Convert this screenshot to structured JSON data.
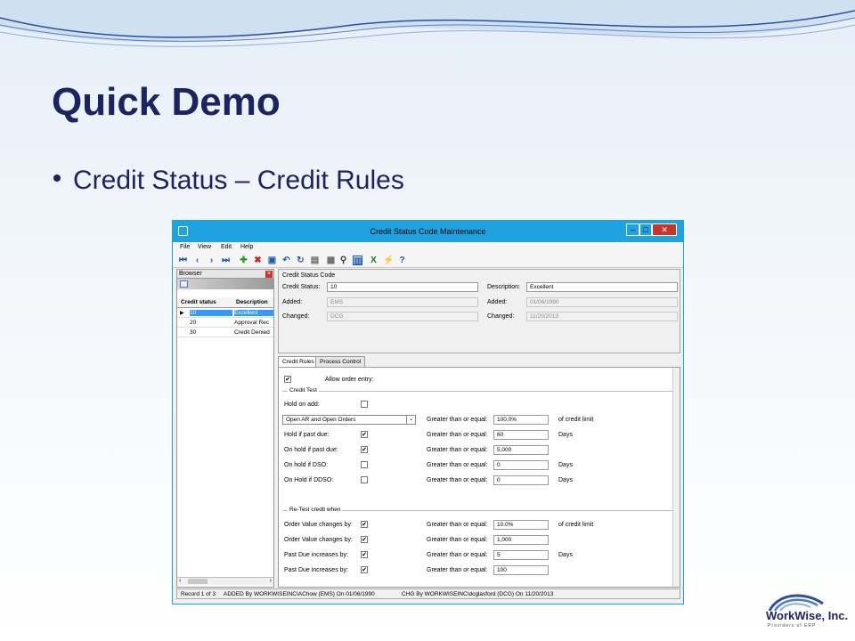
{
  "slide": {
    "title": "Quick Demo",
    "bullet": "Credit Status – Credit Rules"
  },
  "window": {
    "title": "Credit Status Code Maintenance",
    "controls": {
      "min": "–",
      "max": "□",
      "close": "✕"
    },
    "menu": [
      "File",
      "View",
      "Edit",
      "Help"
    ]
  },
  "browser": {
    "title": "Browser",
    "columns": [
      "Credit status",
      "Description"
    ],
    "rows": [
      {
        "code": "10",
        "desc": "Excellent"
      },
      {
        "code": "20",
        "desc": "Approval Rec"
      },
      {
        "code": "30",
        "desc": "Credit Denied"
      }
    ]
  },
  "panel": {
    "group_label": "Credit Status Code",
    "credit_status_label": "Credit Status:",
    "credit_status_value": "10",
    "description_label": "Description:",
    "description_value": "Excellent",
    "added_label": "Added:",
    "added_by": "EMS",
    "added_label2": "Added:",
    "added_date": "01/06/1990",
    "changed_label": "Changed:",
    "changed_by": "DCG",
    "changed_label2": "Changed:",
    "changed_date": "11/20/2013"
  },
  "tabs": [
    "Credit Rules",
    "Process Control"
  ],
  "credit_rules": {
    "allow_order_entry": "Allow order entry:",
    "credit_test_label": "Credit Test",
    "hold_on_add": "Hold on add:",
    "dropdown_value": "Open AR and Open Orders",
    "rows": [
      {
        "label": "",
        "checked": null,
        "gte": "Greater than or equal:",
        "value": "100.0%",
        "unit": "of credit limit"
      },
      {
        "label": "Hold if past due:",
        "checked": true,
        "gte": "Greater than or equal:",
        "value": "60",
        "unit": "Days"
      },
      {
        "label": "On hold if past due:",
        "checked": true,
        "gte": "Greater than or equal:",
        "value": "5,000",
        "unit": ""
      },
      {
        "label": "On hold if DSO:",
        "checked": false,
        "gte": "Greater than or equal:",
        "value": "0",
        "unit": "Days"
      },
      {
        "label": "On Hold if DDSO:",
        "checked": false,
        "gte": "Greater than or equal:",
        "value": "0",
        "unit": "Days"
      }
    ],
    "retest_label": "Re-Test credit when",
    "retest_rows": [
      {
        "label": "Order Value changes by:",
        "gte": "Greater than or equal:",
        "value": "10.0%",
        "unit": "of credit limit"
      },
      {
        "label": "Order Value changes by:",
        "gte": "Greater than or equal:",
        "value": "1,000",
        "unit": ""
      },
      {
        "label": "Past Due increases by:",
        "gte": "Greater than or equal:",
        "value": "5",
        "unit": "Days"
      },
      {
        "label": "Past Due increases by:",
        "gte": "Greater than or equal:",
        "value": "100",
        "unit": ""
      }
    ]
  },
  "status": {
    "record": "Record 1 of 3",
    "added": "ADDED By WORKWISEINC\\AChow (EMS)  On 01/06/1990",
    "changed": "CHG By WORKWISEINC\\dcglasford (DCG)   On 11/20/2013"
  },
  "logo": {
    "name": "WorkWise, Inc.",
    "tagline": "Providers of ERP"
  }
}
